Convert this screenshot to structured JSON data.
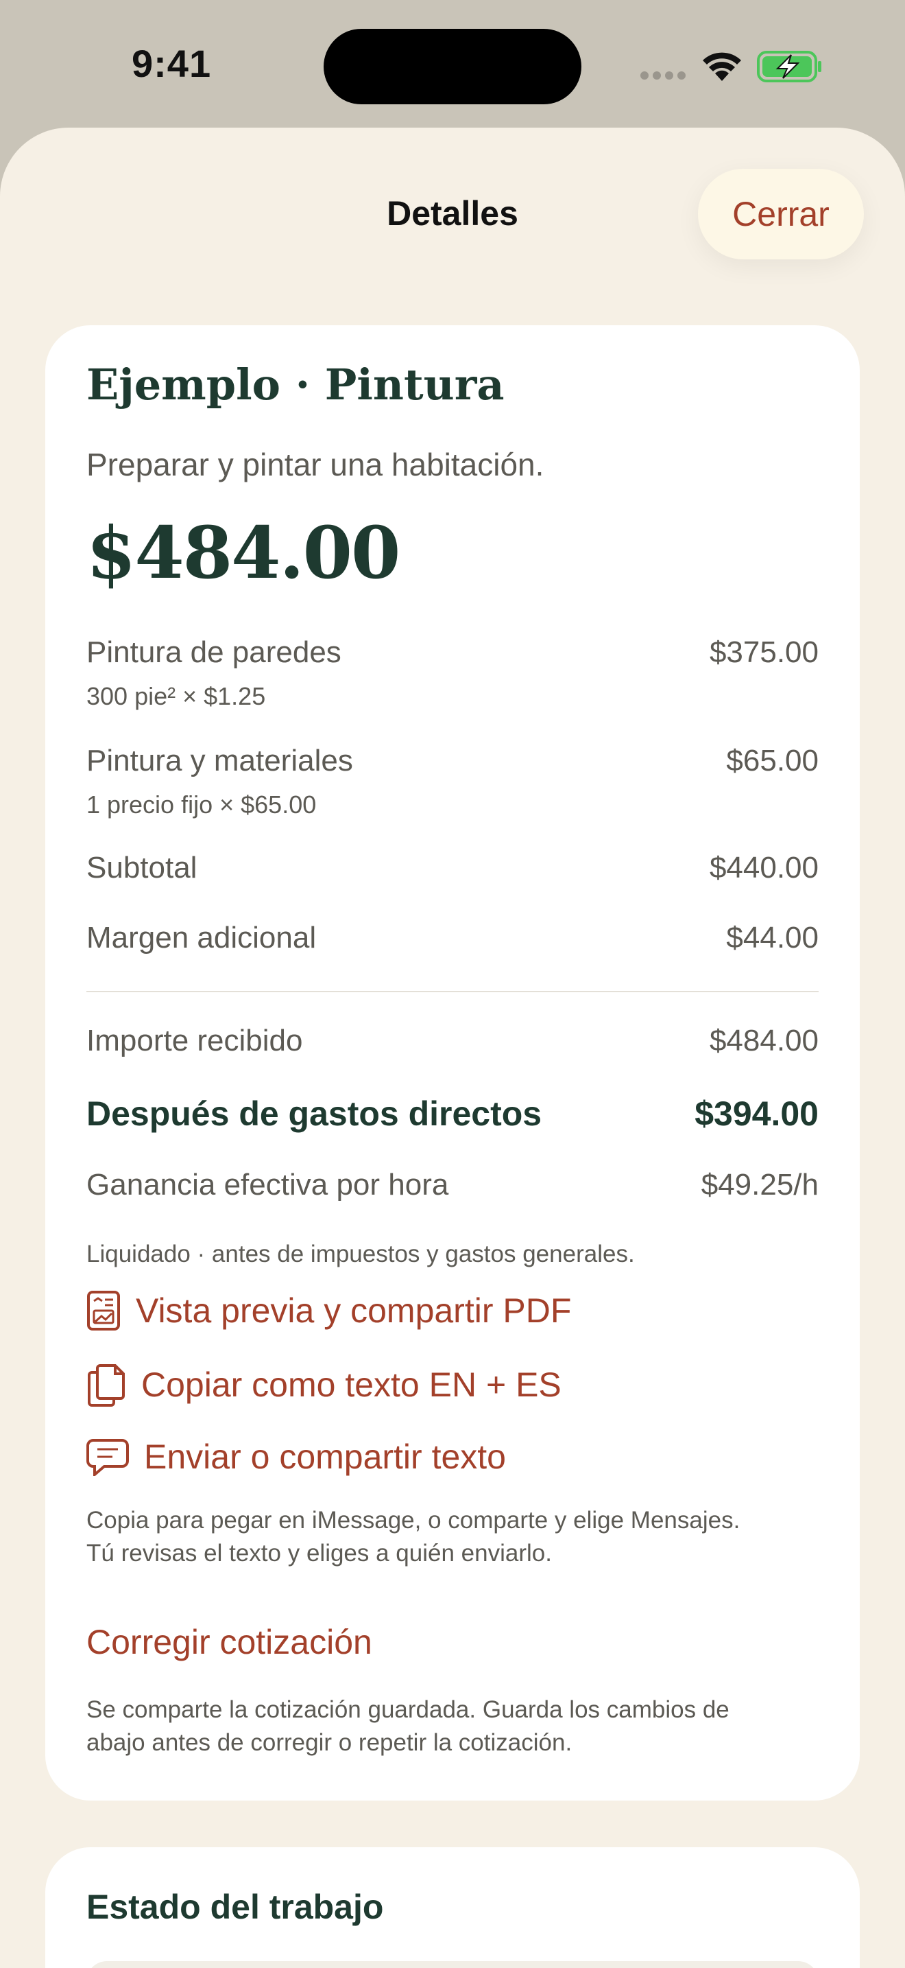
{
  "status_bar": {
    "time": "9:41"
  },
  "sheet": {
    "title": "Detalles",
    "close_label": "Cerrar"
  },
  "quote": {
    "title": "Ejemplo · Pintura",
    "description": "Preparar y pintar una habitación.",
    "total": "$484.00",
    "line_items": [
      {
        "label": "Pintura de paredes",
        "detail": "300 pie² × $1.25",
        "amount": "$375.00"
      },
      {
        "label": "Pintura y materiales",
        "detail": "1 precio fijo × $65.00",
        "amount": "$65.00"
      }
    ],
    "subtotal": {
      "label": "Subtotal",
      "amount": "$440.00"
    },
    "margin": {
      "label": "Margen adicional",
      "amount": "$44.00"
    },
    "received": {
      "label": "Importe recibido",
      "amount": "$484.00"
    },
    "after_costs": {
      "label": "Después de gastos directos",
      "amount": "$394.00"
    },
    "hourly": {
      "label": "Ganancia efectiva por hora",
      "amount": "$49.25/h"
    },
    "note": "Liquidado · antes de impuestos y gastos generales."
  },
  "actions": {
    "pdf": "Vista previa y compartir PDF",
    "copy": "Copiar como texto EN + ES",
    "send": "Enviar o compartir texto",
    "share_note_1": "Copia para pegar en iMessage, o comparte y elige Mensajes.",
    "share_note_2": "Tú revisas el texto y eliges a quién enviarlo.",
    "correct": "Corregir cotización",
    "saved_note_1": "Se comparte la cotización guardada. Guarda los cambios de",
    "saved_note_2": "abajo antes de corregir o repetir la cotización."
  },
  "job_status": {
    "title": "Estado del trabajo"
  },
  "colors": {
    "accent": "#a3402a",
    "heading": "#1e3a30",
    "sheet_bg": "#f6f0e5",
    "battery": "#4cc65a"
  },
  "icons": [
    "wifi-icon",
    "battery-charging-icon",
    "pdf-document-icon",
    "copy-icon",
    "message-icon"
  ]
}
